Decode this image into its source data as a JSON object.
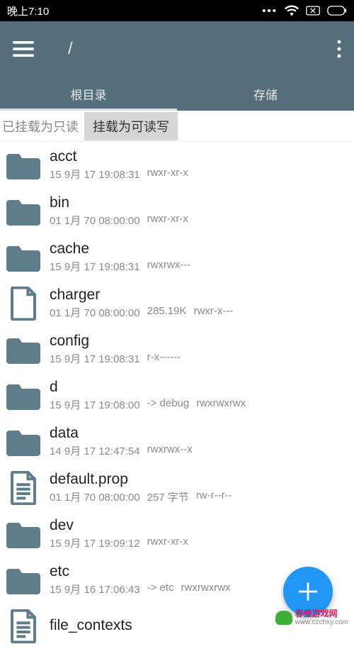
{
  "status": {
    "time": "晚上7:10"
  },
  "header": {
    "path": "/",
    "tabs": [
      {
        "label": "根目录",
        "active": true
      },
      {
        "label": "存储",
        "active": false
      }
    ]
  },
  "mount": {
    "readonly_label": "已挂载为只读",
    "rw_button": "挂载为可读写"
  },
  "files": [
    {
      "type": "folder",
      "name": "acct",
      "date": "15 9月 17 19:08:31",
      "size": "",
      "link": "",
      "perm": "rwxr-xr-x"
    },
    {
      "type": "folder",
      "name": "bin",
      "date": "01 1月 70 08:00:00",
      "size": "",
      "link": "",
      "perm": "rwxr-xr-x"
    },
    {
      "type": "folder",
      "name": "cache",
      "date": "15 9月 17 19:08:31",
      "size": "",
      "link": "",
      "perm": "rwxrwx---"
    },
    {
      "type": "file",
      "name": "charger",
      "date": "01 1月 70 08:00:00",
      "size": "285.19K",
      "link": "",
      "perm": "rwxr-x---"
    },
    {
      "type": "folder",
      "name": "config",
      "date": "15 9月 17 19:08:31",
      "size": "",
      "link": "",
      "perm": "r-x------"
    },
    {
      "type": "folder",
      "name": "d",
      "date": "15 9月 17 19:08:00",
      "size": "",
      "link": "-> debug",
      "perm": "rwxrwxrwx"
    },
    {
      "type": "folder",
      "name": "data",
      "date": "14 9月 17 12:47:54",
      "size": "",
      "link": "",
      "perm": "rwxrwx--x"
    },
    {
      "type": "textfile",
      "name": "default.prop",
      "date": "01 1月 70 08:00:00",
      "size": "257 字节",
      "link": "",
      "perm": "rw-r--r--"
    },
    {
      "type": "folder",
      "name": "dev",
      "date": "15 9月 17 19:09:12",
      "size": "",
      "link": "",
      "perm": "rwxr-xr-x"
    },
    {
      "type": "folder",
      "name": "etc",
      "date": "15 9月 16 17:06:43",
      "size": "",
      "link": "-> etc",
      "perm": "rwxrwxrwx"
    },
    {
      "type": "textfile",
      "name": "file_contexts",
      "date": "",
      "size": "",
      "link": "",
      "perm": ""
    }
  ],
  "watermark": {
    "name": "春蚕游戏网",
    "url": "www.czchxy.com"
  }
}
